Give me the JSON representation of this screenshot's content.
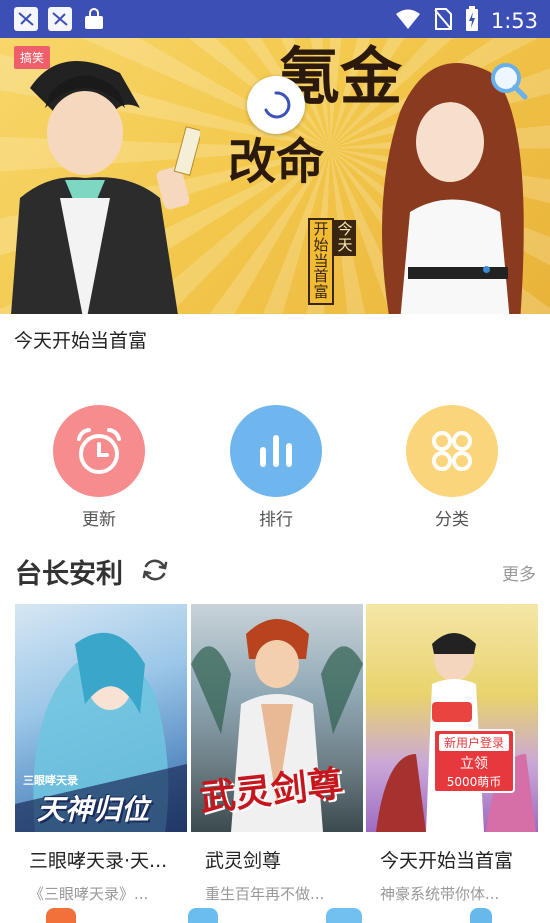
{
  "status_bar": {
    "time": "1:53",
    "icons": [
      "app-notification-icon",
      "app-notification-icon",
      "shopping-bag-icon",
      "wifi-icon",
      "no-sim-icon",
      "battery-charging-icon"
    ]
  },
  "banner": {
    "tag": "搞笑",
    "headline_top": "氪金",
    "headline_bottom": "改命",
    "vertical_caption_1": "开始当首富",
    "vertical_caption_2": "今天",
    "title": "今天开始当首富"
  },
  "categories": [
    {
      "label": "更新",
      "icon": "alarm-clock-icon",
      "color": "#f68c8d"
    },
    {
      "label": "排行",
      "icon": "bar-chart-icon",
      "color": "#6fb6ef"
    },
    {
      "label": "分类",
      "icon": "grid-circles-icon",
      "color": "#fbd57b"
    }
  ],
  "section": {
    "title": "台长安利",
    "more": "更多"
  },
  "comics": [
    {
      "title": "三眼哮天录·天...",
      "desc": "《三眼哮天录》...",
      "cover_text": "天神归位",
      "cover_sub": "三眼哮天录"
    },
    {
      "title": "武灵剑尊",
      "desc": "重生百年再不做...",
      "cover_text": "武灵剑尊"
    },
    {
      "title": "今天开始当首富",
      "desc": "神豪系统带你体...",
      "promo_line1": "新用户登录",
      "promo_line2": "立领",
      "promo_line3": "5000萌币"
    }
  ]
}
